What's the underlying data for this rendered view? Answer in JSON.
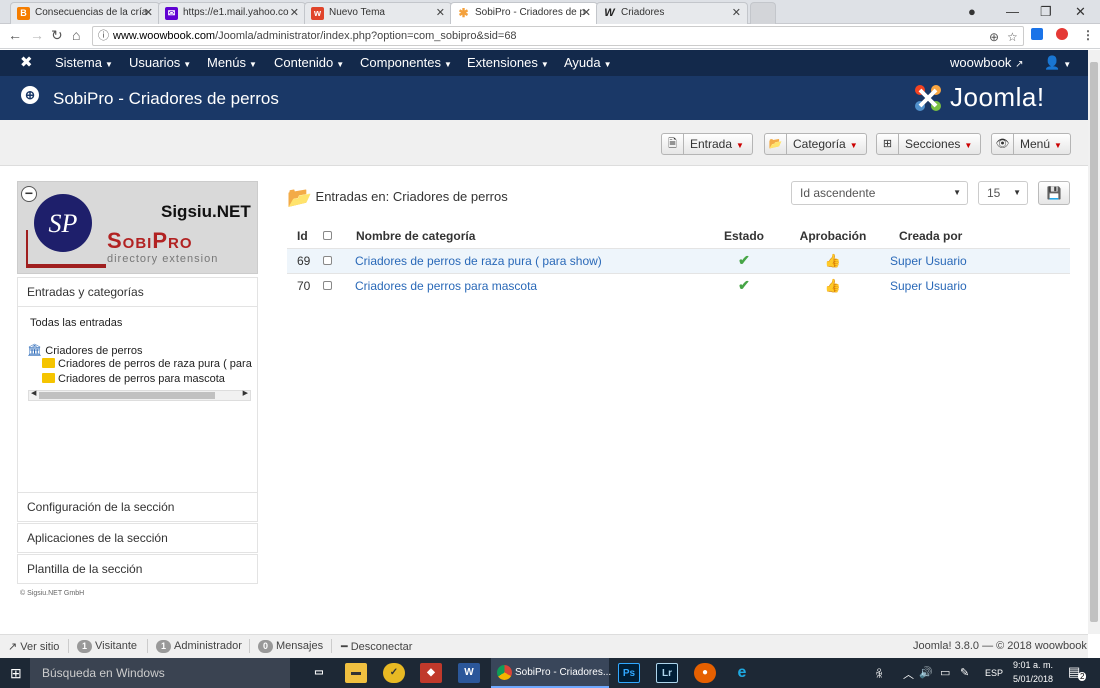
{
  "browser": {
    "tabs": [
      {
        "title": "Consecuencias de la cría",
        "icon": "blogger-icon"
      },
      {
        "title": "https://e1.mail.yahoo.co",
        "icon": "yahoo-mail-icon"
      },
      {
        "title": "Nuevo Tema",
        "icon": "wix-icon"
      },
      {
        "title": "SobiPro - Criadores de p",
        "icon": "joomla-icon"
      },
      {
        "title": "Criadores",
        "icon": "woowbook-icon"
      }
    ],
    "url_host": "www.woowbook.com",
    "url_path": "/Joomla/administrator/index.php?option=com_sobipro&sid=68"
  },
  "navbar": {
    "menus": [
      "Sistema",
      "Usuarios",
      "Menús",
      "Contenido",
      "Componentes",
      "Extensiones",
      "Ayuda"
    ],
    "user": "woowbook"
  },
  "header": {
    "title": "SobiPro - Criadores de perros",
    "brand": "Joomla!"
  },
  "toolbar": {
    "buttons": [
      "Entrada",
      "Categoría",
      "Secciones",
      "Menú"
    ]
  },
  "sidebar": {
    "logo_title": "Sigsiu.NET",
    "logo_brand": "SobiPro",
    "logo_sub": "directory extension",
    "entries_label": "Entradas y categorías",
    "all_entries": "Todas las entradas",
    "tree_root": "Criadores de perros",
    "tree_children": [
      "Criadores de perros de raza pura ( para",
      "Criadores de perros para mascota"
    ],
    "config": "Configuración de la sección",
    "apps": "Aplicaciones de la sección",
    "template": "Plantilla de la sección",
    "copyright": "© Sigsiu.NET GmbH"
  },
  "main": {
    "title": "Entradas en: Criadores de perros",
    "sort": "Id ascendente",
    "limit": "15",
    "columns": [
      "Id",
      "Nombre de categoría",
      "Estado",
      "Aprobación",
      "Creada por"
    ],
    "rows": [
      {
        "id": "69",
        "name": "Criadores de perros de raza pura ( para show)",
        "author": "Super Usuario"
      },
      {
        "id": "70",
        "name": "Criadores de perros para mascota",
        "author": "Super Usuario"
      }
    ]
  },
  "status": {
    "view_site": "Ver sitio",
    "visitors_count": "1",
    "visitors": "Visitante",
    "admins_count": "1",
    "admins": "Administrador",
    "messages_count": "0",
    "messages": "Mensajes",
    "logout": "Desconectar",
    "version": "Joomla! 3.8.0 — © 2018 woowbook"
  },
  "taskbar": {
    "search": "Búsqueda en Windows",
    "chrome_label": "SobiPro - Criadores...",
    "lang": "ESP",
    "time": "9:01 a. m.",
    "date": "5/01/2018",
    "notif": "2"
  },
  "colors": {
    "nav": "#13294b",
    "header": "#1a3867",
    "link": "#2a69b8",
    "check": "#46a546"
  }
}
